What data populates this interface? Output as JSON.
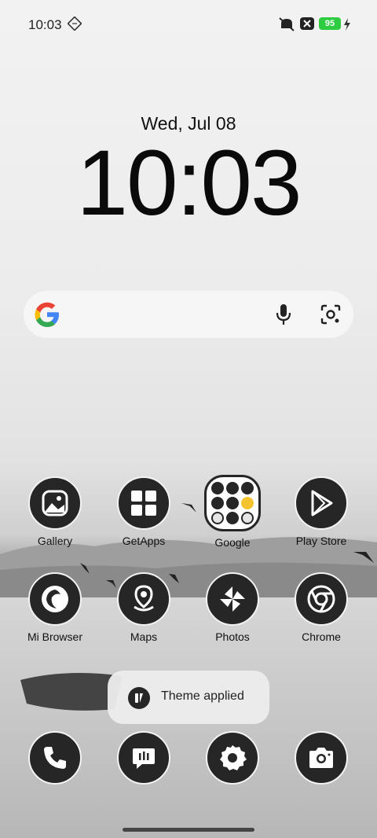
{
  "status_bar": {
    "time": "10:03",
    "battery_level": "95",
    "icons": [
      "mute-icon",
      "close-box-icon",
      "charging-bolt-icon",
      "network-icon"
    ]
  },
  "lock": {
    "date": "Wed, Jul 08",
    "clock": "10:03"
  },
  "search_bar": {
    "icons": [
      "google-logo",
      "mic-icon",
      "lens-icon"
    ]
  },
  "apps": [
    {
      "label": "Gallery",
      "icon": "gallery-icon"
    },
    {
      "label": "GetApps",
      "icon": "getapps-icon"
    },
    {
      "label": "Google",
      "icon": "folder-icon"
    },
    {
      "label": "Play Store",
      "icon": "play-store-icon"
    },
    {
      "label": "Mi Browser",
      "icon": "browser-icon"
    },
    {
      "label": "Maps",
      "icon": "maps-icon"
    },
    {
      "label": "Photos",
      "icon": "photos-icon"
    },
    {
      "label": "Chrome",
      "icon": "chrome-icon"
    }
  ],
  "dock": [
    {
      "icon": "phone-icon"
    },
    {
      "icon": "messages-icon"
    },
    {
      "icon": "settings-icon"
    },
    {
      "icon": "camera-icon"
    }
  ],
  "toast": {
    "text": "Theme applied"
  },
  "colors": {
    "icon_bg": "#262626",
    "battery": "#2ecc40"
  }
}
